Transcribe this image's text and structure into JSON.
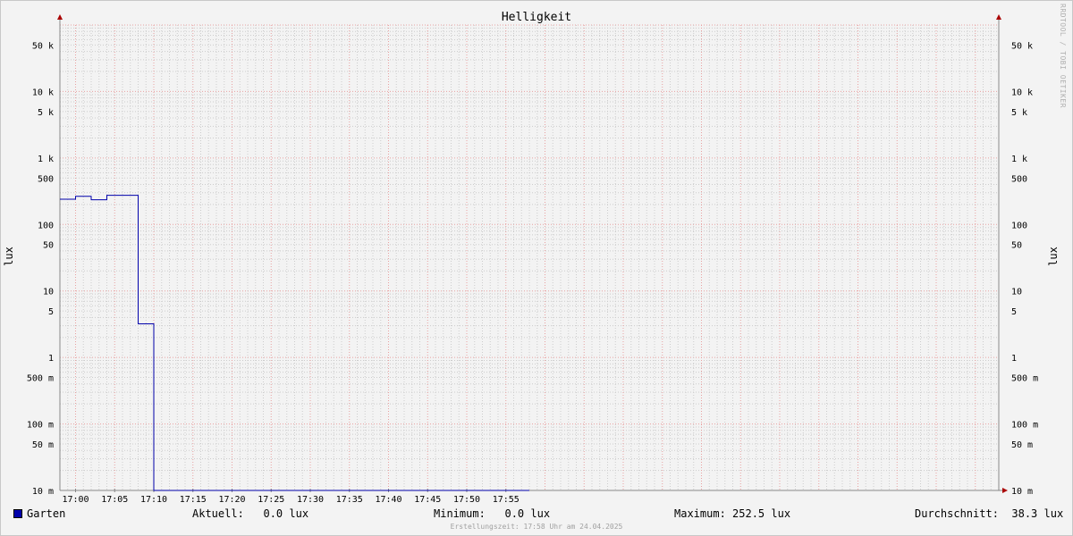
{
  "chart_data": {
    "type": "line",
    "title": "Helligkeit",
    "ylabel": "lux",
    "yscale": "log",
    "ylim": [
      0.01,
      100000
    ],
    "xlim": [
      "16:58",
      "18:58"
    ],
    "y_tick_labels": [
      {
        "value": 50000,
        "label": "50 k"
      },
      {
        "value": 10000,
        "label": "10 k"
      },
      {
        "value": 5000,
        "label": "5 k"
      },
      {
        "value": 1000,
        "label": "1 k"
      },
      {
        "value": 500,
        "label": "500"
      },
      {
        "value": 100,
        "label": "100"
      },
      {
        "value": 50,
        "label": "50"
      },
      {
        "value": 10,
        "label": "10"
      },
      {
        "value": 5,
        "label": "5"
      },
      {
        "value": 1,
        "label": "1"
      },
      {
        "value": 0.5,
        "label": "500 m"
      },
      {
        "value": 0.1,
        "label": "100 m"
      },
      {
        "value": 0.05,
        "label": "50 m"
      },
      {
        "value": 0.01,
        "label": "10 m"
      }
    ],
    "x_tick_labels": [
      "17:00",
      "17:05",
      "17:10",
      "17:15",
      "17:20",
      "17:25",
      "17:30",
      "17:35",
      "17:40",
      "17:45",
      "17:50",
      "17:55"
    ],
    "grid": true,
    "series": [
      {
        "name": "Garten",
        "color": "#0000aa",
        "step": true,
        "x": [
          "16:58",
          "17:00",
          "17:02",
          "17:04",
          "17:06",
          "17:08",
          "17:10",
          "17:12",
          "17:58"
        ],
        "y": [
          240,
          265,
          235,
          275,
          275,
          3.2,
          0,
          0,
          0
        ]
      }
    ]
  },
  "legend": {
    "series_name": "Garten",
    "aktuell": "Aktuell:   0.0 lux",
    "minimum": "Minimum:   0.0 lux",
    "maximum": "Maximum: 252.5 lux",
    "durchschnitt": "Durchschnitt:  38.3 lux"
  },
  "footer": "Erstellungszeit: 17:58 Uhr am 24.04.2025",
  "watermark": "RRDTOOL / TOBI OETIKER",
  "colors": {
    "series": "#0000aa",
    "major_grid": "#e8a0a0",
    "minor_grid": "#cccccc",
    "axis": "#888888",
    "arrow": "#aa0000"
  }
}
